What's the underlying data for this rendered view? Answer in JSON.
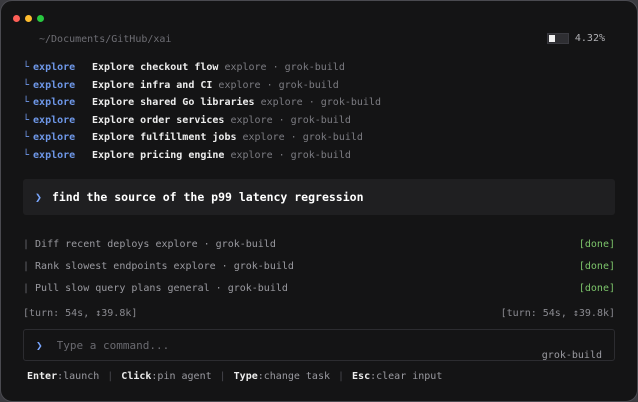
{
  "window": {
    "controls": [
      "close",
      "minimize",
      "maximize"
    ]
  },
  "header": {
    "path": "~/Documents/GitHub/xai",
    "usage_percent_text": "4.32%",
    "usage_fraction": 0.0432
  },
  "agents": [
    {
      "kind": "explore",
      "task": "Explore checkout flow",
      "meta": "explore · grok-build"
    },
    {
      "kind": "explore",
      "task": "Explore infra and CI",
      "meta": "explore · grok-build"
    },
    {
      "kind": "explore",
      "task": "Explore shared Go libraries",
      "meta": "explore · grok-build"
    },
    {
      "kind": "explore",
      "task": "Explore order services",
      "meta": "explore · grok-build"
    },
    {
      "kind": "explore",
      "task": "Explore fulfillment jobs",
      "meta": "explore · grok-build"
    },
    {
      "kind": "explore",
      "task": "Explore pricing engine",
      "meta": "explore · grok-build"
    }
  ],
  "prompt": {
    "text": "find the source of the p99 latency regression"
  },
  "tasks": [
    {
      "label": "Diff recent deploys explore · grok-build",
      "status": "[done]"
    },
    {
      "label": "Rank slowest endpoints explore · grok-build",
      "status": "[done]"
    },
    {
      "label": "Pull slow query plans general · grok-build",
      "status": "[done]"
    }
  ],
  "turn": {
    "left": "[turn: 54s, ↕39.8k]",
    "right": "[turn: 54s, ↕39.8k]"
  },
  "input": {
    "placeholder": "Type a command...",
    "value": "",
    "model": "grok-build"
  },
  "hints": [
    {
      "key": "Enter",
      "action": ":launch"
    },
    {
      "key": "Click",
      "action": ":pin agent"
    },
    {
      "key": "Type",
      "action": ":change task"
    },
    {
      "key": "Esc",
      "action": ":clear input"
    }
  ],
  "colors": {
    "accent": "#6e97e8",
    "done": "#7cc46a",
    "background": "#141415"
  }
}
